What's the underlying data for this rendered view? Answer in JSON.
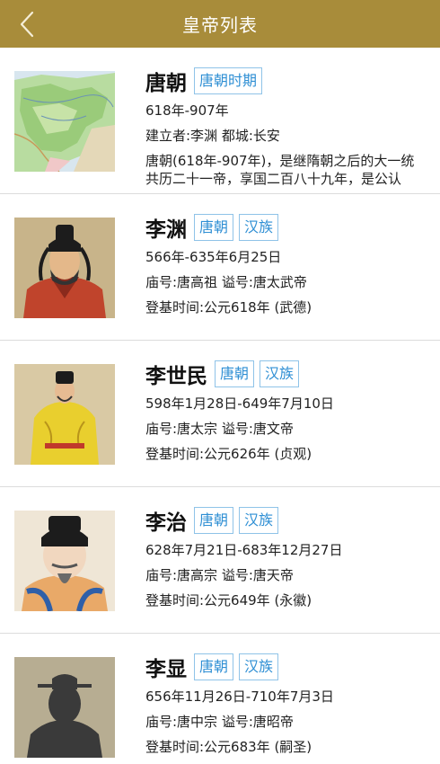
{
  "header": {
    "title": "皇帝列表",
    "back_icon": "back-chevron-icon"
  },
  "colors": {
    "header_bg": "#a88c3a",
    "tag_text": "#2f8fd4",
    "tag_border": "#8fc3e8"
  },
  "items": [
    {
      "name": "唐朝",
      "tags": [
        "唐朝时期"
      ],
      "line1": "618年-907年",
      "line2": "建立者:李渊  都城:长安",
      "desc1": "唐朝(618年-907年)，是继隋朝之后的大一统",
      "desc2": "共历二十一帝，享国二百八十九年，是公认",
      "image": "map-thumbnail"
    },
    {
      "name": "李渊",
      "tags": [
        "唐朝",
        "汉族"
      ],
      "line1": "566年-635年6月25日",
      "line2": "庙号:唐高祖 谥号:唐太武帝",
      "line3": "登基时间:公元618年 (武德)",
      "image": "portrait-li-yuan"
    },
    {
      "name": "李世民",
      "tags": [
        "唐朝",
        "汉族"
      ],
      "line1": "598年1月28日-649年7月10日",
      "line2": "庙号:唐太宗 谥号:唐文帝",
      "line3": "登基时间:公元626年 (贞观)",
      "image": "portrait-li-shimin"
    },
    {
      "name": "李治",
      "tags": [
        "唐朝",
        "汉族"
      ],
      "line1": "628年7月21日-683年12月27日",
      "line2": "庙号:唐高宗 谥号:唐天帝",
      "line3": "登基时间:公元649年 (永徽)",
      "image": "portrait-li-zhi"
    },
    {
      "name": "李显",
      "tags": [
        "唐朝",
        "汉族"
      ],
      "line1": "656年11月26日-710年7月3日",
      "line2": "庙号:唐中宗 谥号:唐昭帝",
      "line3": "登基时间:公元683年 (嗣圣)",
      "image": "silhouette-placeholder"
    }
  ]
}
